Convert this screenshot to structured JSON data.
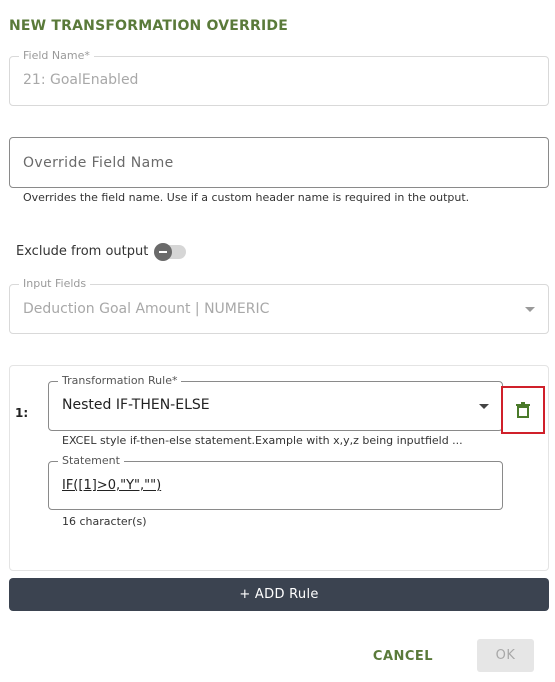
{
  "dialog": {
    "title": "NEW TRANSFORMATION OVERRIDE"
  },
  "field_name": {
    "label": "Field Name*",
    "value": "21: GoalEnabled"
  },
  "override_field_name": {
    "placeholder": "Override Field Name",
    "helper": "Overrides the field name. Use if a custom header name is required in the output."
  },
  "exclude_from_output": {
    "label": "Exclude from output",
    "checked": false
  },
  "input_fields": {
    "label": "Input Fields",
    "value": "Deduction Goal Amount | NUMERIC"
  },
  "rules": [
    {
      "index": "1:",
      "transformation_rule_label": "Transformation Rule*",
      "transformation_rule_value": "Nested IF-THEN-ELSE",
      "description": "EXCEL style if-then-else statement.Example with x,y,z being inputfield ...",
      "statement_label": "Statement",
      "statement_value": "IF([1]>0,\"Y\",\"\")",
      "char_count": "16 character(s)"
    }
  ],
  "actions": {
    "add_rule": "+ ADD Rule",
    "cancel": "CANCEL",
    "ok": "OK"
  },
  "colors": {
    "accent_green": "#5a7a3a",
    "delete_icon": "#4a7a2a",
    "highlight_red": "#d0202a",
    "add_rule_bg": "#3b4350"
  },
  "icons": {
    "delete": "trash-icon",
    "dropdown": "caret-down-icon"
  }
}
